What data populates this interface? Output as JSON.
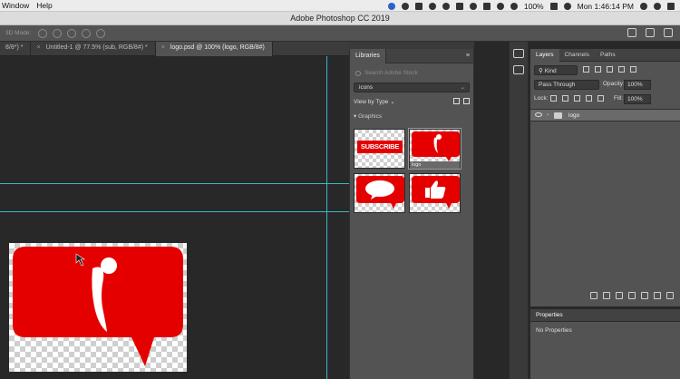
{
  "menubar": {
    "items": [
      "Window",
      "Help"
    ],
    "battery": "100%",
    "clock": "Mon 1:46:14 PM"
  },
  "titlebar": {
    "title": "Adobe Photoshop CC 2019"
  },
  "optionsbar": {
    "mode_label": "3D Mode:"
  },
  "tabs": [
    {
      "label": "8/8*) *",
      "active": false
    },
    {
      "label": "Untitled-1 @ 77.5% (sub, RGB/8#) *",
      "active": false
    },
    {
      "label": "logo.psd @ 100% (logo, RGB/8#)",
      "active": true
    }
  ],
  "libraries": {
    "title": "Libraries",
    "search_placeholder": "Search Adobe Stock",
    "library_name": "icons",
    "view_by": "View by Type",
    "section": "Graphics",
    "items": [
      {
        "label": "SUBSCRIBE"
      },
      {
        "label": "logo"
      },
      {
        "label": ""
      },
      {
        "label": ""
      }
    ]
  },
  "layers": {
    "tabs": [
      "Layers",
      "Channels",
      "Paths"
    ],
    "kind_label": "Kind",
    "blend_mode": "Pass Through",
    "opacity_label": "Opacity:",
    "opacity_value": "100%",
    "lock_label": "Lock:",
    "fill_label": "Fill:",
    "fill_value": "100%",
    "layer_name": "logo"
  },
  "properties": {
    "title": "Properties",
    "content": "No Properties"
  },
  "colors": {
    "brand_red": "#e50000",
    "guide": "#38b7c7"
  }
}
